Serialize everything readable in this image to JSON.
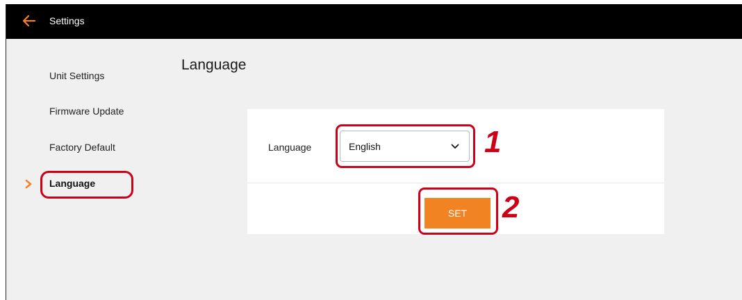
{
  "header": {
    "title": "Settings",
    "back_icon": "arrow-left-icon",
    "accent_color": "#f28322"
  },
  "sidebar": {
    "items": [
      {
        "label": "Unit Settings",
        "active": false
      },
      {
        "label": "Firmware Update",
        "active": false
      },
      {
        "label": "Factory Default",
        "active": false
      },
      {
        "label": "Language",
        "active": true
      }
    ],
    "active_marker_icon": "chevron-right-icon"
  },
  "main": {
    "title": "Language",
    "language_field": {
      "label": "Language",
      "selected": "English",
      "dropdown_icon": "chevron-down-icon"
    },
    "set_button_label": "SET"
  },
  "annotations": {
    "step1": "1",
    "step2": "2",
    "highlight_color": "#cc0016"
  }
}
